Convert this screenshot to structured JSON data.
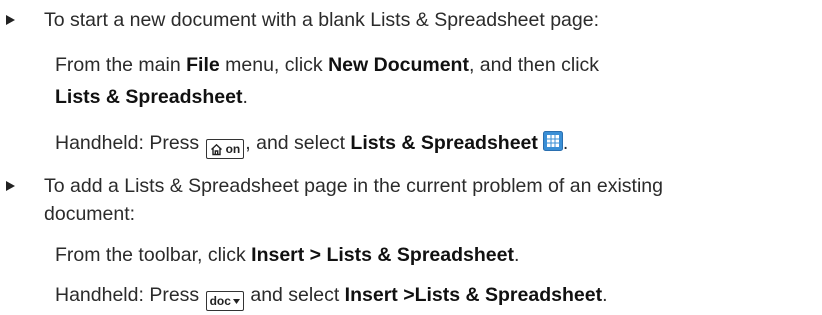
{
  "bullet1": {
    "intro": "To start a new document with a blank Lists & Spreadsheet page:",
    "step": {
      "prefix": "From the main ",
      "menu": "File",
      "mid": " menu, click ",
      "cmd1": "New Document",
      "suffix": ", and then click",
      "cmd2": "Lists & Spreadsheet",
      "end": "."
    },
    "handheld": {
      "prefix": "Handheld: Press ",
      "key": "on",
      "key_icon": "home-icon",
      "mid": ", and select ",
      "target": "Lists & Spreadsheet",
      "target_icon": "lists-spreadsheet-icon",
      "end": "."
    }
  },
  "bullet2": {
    "intro_line1": "To add a Lists & Spreadsheet page in the current problem of an existing",
    "intro_line2": "document:",
    "step": {
      "prefix": "From the toolbar, click ",
      "cmd": "Insert > Lists & Spreadsheet",
      "end": "."
    },
    "handheld": {
      "prefix": "Handheld: Press ",
      "key": "doc",
      "key_icon": "dropdown-arrow-icon",
      "mid": " and select ",
      "target": "Insert >Lists & Spreadsheet",
      "end": "."
    }
  },
  "colors": {
    "text": "#2b2b2b",
    "bold": "#111111",
    "icon_blue": "#3a8fd6"
  }
}
